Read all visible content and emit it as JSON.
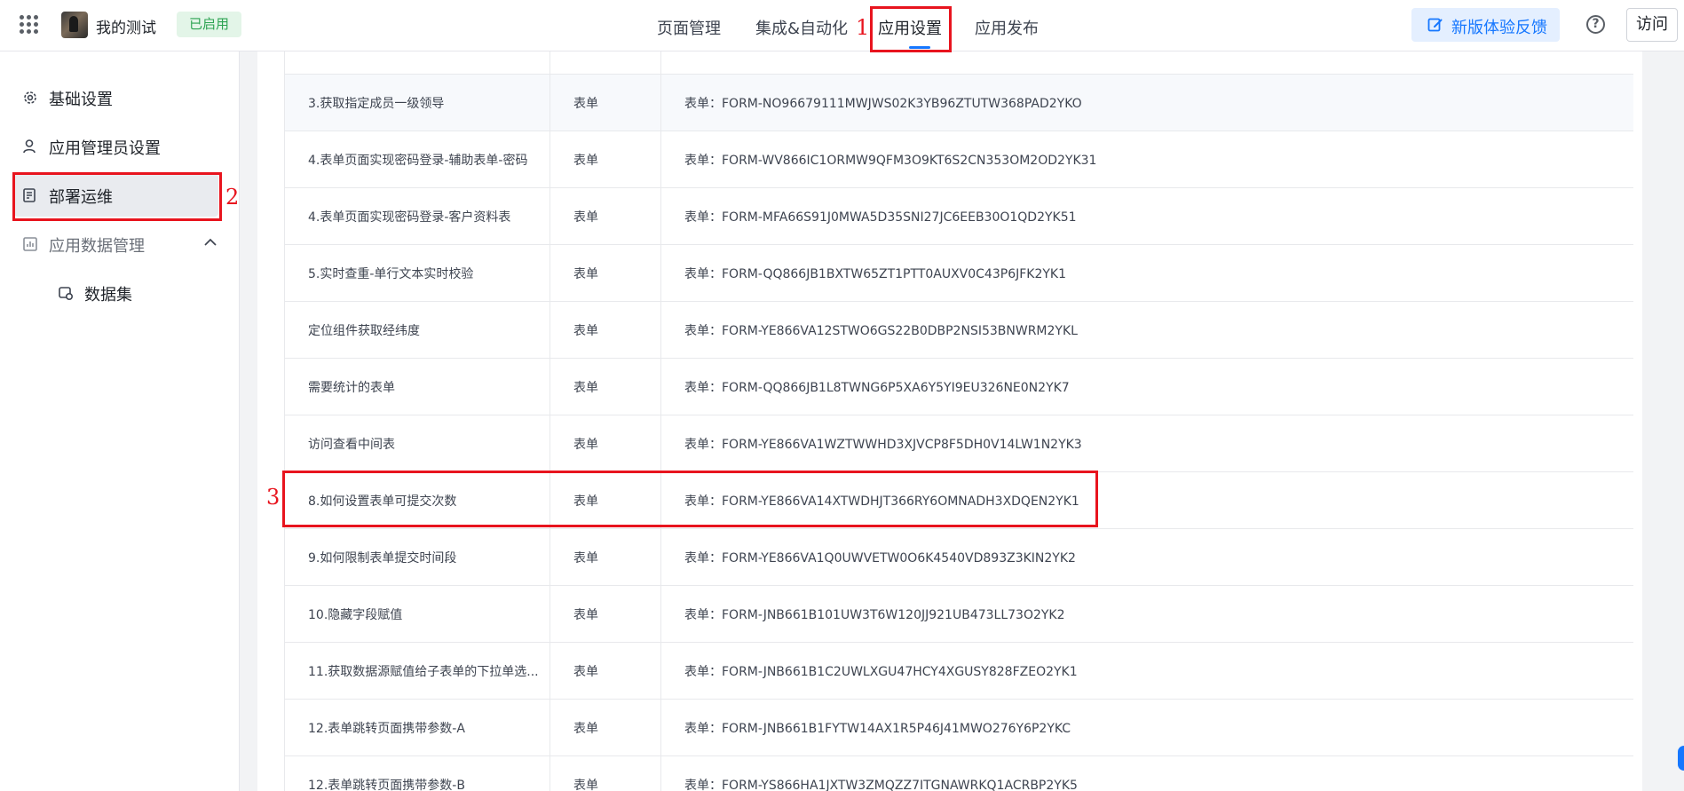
{
  "header": {
    "app_name": "我的测试",
    "status": "已启用",
    "tabs": [
      {
        "label": "页面管理"
      },
      {
        "label": "集成&自动化"
      },
      {
        "label": "应用设置"
      },
      {
        "label": "应用发布"
      }
    ],
    "active_tab": "应用设置",
    "feedback_label": "新版体验反馈",
    "help_glyph": "?",
    "visit_label": "访问"
  },
  "sidebar": {
    "items": [
      {
        "label": "基础设置",
        "icon": "gear-icon"
      },
      {
        "label": "应用管理员设置",
        "icon": "user-icon"
      },
      {
        "label": "部署运维",
        "icon": "deploy-icon"
      },
      {
        "label": "应用数据管理",
        "icon": "data-icon"
      }
    ],
    "active": "部署运维",
    "sub_items": [
      {
        "label": "数据集",
        "icon": "dataset-icon"
      }
    ]
  },
  "table": {
    "rows": [
      {
        "name": "3.获取指定成员一级领导",
        "type": "表单",
        "code": "表单：FORM-NO96679111MWJWS02K3YB96ZTUTW368PAD2YKO"
      },
      {
        "name": "4.表单页面实现密码登录-辅助表单-密码",
        "type": "表单",
        "code": "表单：FORM-WV866IC1ORMW9QFM3O9KT6S2CN353OM2OD2YK31"
      },
      {
        "name": "4.表单页面实现密码登录-客户资料表",
        "type": "表单",
        "code": "表单：FORM-MFA66S91J0MWA5D35SNI27JC6EEB30O1QD2YK51"
      },
      {
        "name": "5.实时查重-单行文本实时校验",
        "type": "表单",
        "code": "表单：FORM-QQ866JB1BXTW65ZT1PTT0AUXV0C43P6JFK2YK1"
      },
      {
        "name": "定位组件获取经纬度",
        "type": "表单",
        "code": "表单：FORM-YE866VA12STWO6GS22B0DBP2NSI53BNWRM2YKL"
      },
      {
        "name": "需要统计的表单",
        "type": "表单",
        "code": "表单：FORM-QQ866JB1L8TWNG6P5XA6Y5YI9EU326NE0N2YK7"
      },
      {
        "name": "访问查看中间表",
        "type": "表单",
        "code": "表单：FORM-YE866VA1WZTWWHD3XJVCP8F5DH0V14LW1N2YK3"
      },
      {
        "name": "8.如何设置表单可提交次数",
        "type": "表单",
        "code": "表单：FORM-YE866VA14XTWDHJT366RY6OMNADH3XDQEN2YK1"
      },
      {
        "name": "9.如何限制表单提交时间段",
        "type": "表单",
        "code": "表单：FORM-YE866VA1Q0UWVETW0O6K4540VD893Z3KIN2YK2"
      },
      {
        "name": "10.隐藏字段赋值",
        "type": "表单",
        "code": "表单：FORM-JNB661B101UW3T6W120JJ921UB473LL73O2YK2"
      },
      {
        "name": "11.获取数据源赋值给子表单的下拉单选...",
        "type": "表单",
        "code": "表单：FORM-JNB661B1C2UWLXGU47HCY4XGUSY828FZEO2YK1"
      },
      {
        "name": "12.表单跳转页面携带参数-A",
        "type": "表单",
        "code": "表单：FORM-JNB661B1FYTW14AX1R5P46J41MWO276Y6P2YKC"
      },
      {
        "name": "12.表单跳转页面携带参数-B",
        "type": "表单",
        "code": "表单：FORM-YS866HA1JXTW3ZMQZZ7ITGNAWRKQ1ACRBP2YK5"
      }
    ]
  },
  "annotations": [
    {
      "number": "1"
    },
    {
      "number": "2"
    },
    {
      "number": "3"
    }
  ],
  "colors": {
    "accent": "#1677ff",
    "annotation": "#e8141e",
    "status_bg": "#e3f5e8",
    "status_text": "#2ca352"
  }
}
